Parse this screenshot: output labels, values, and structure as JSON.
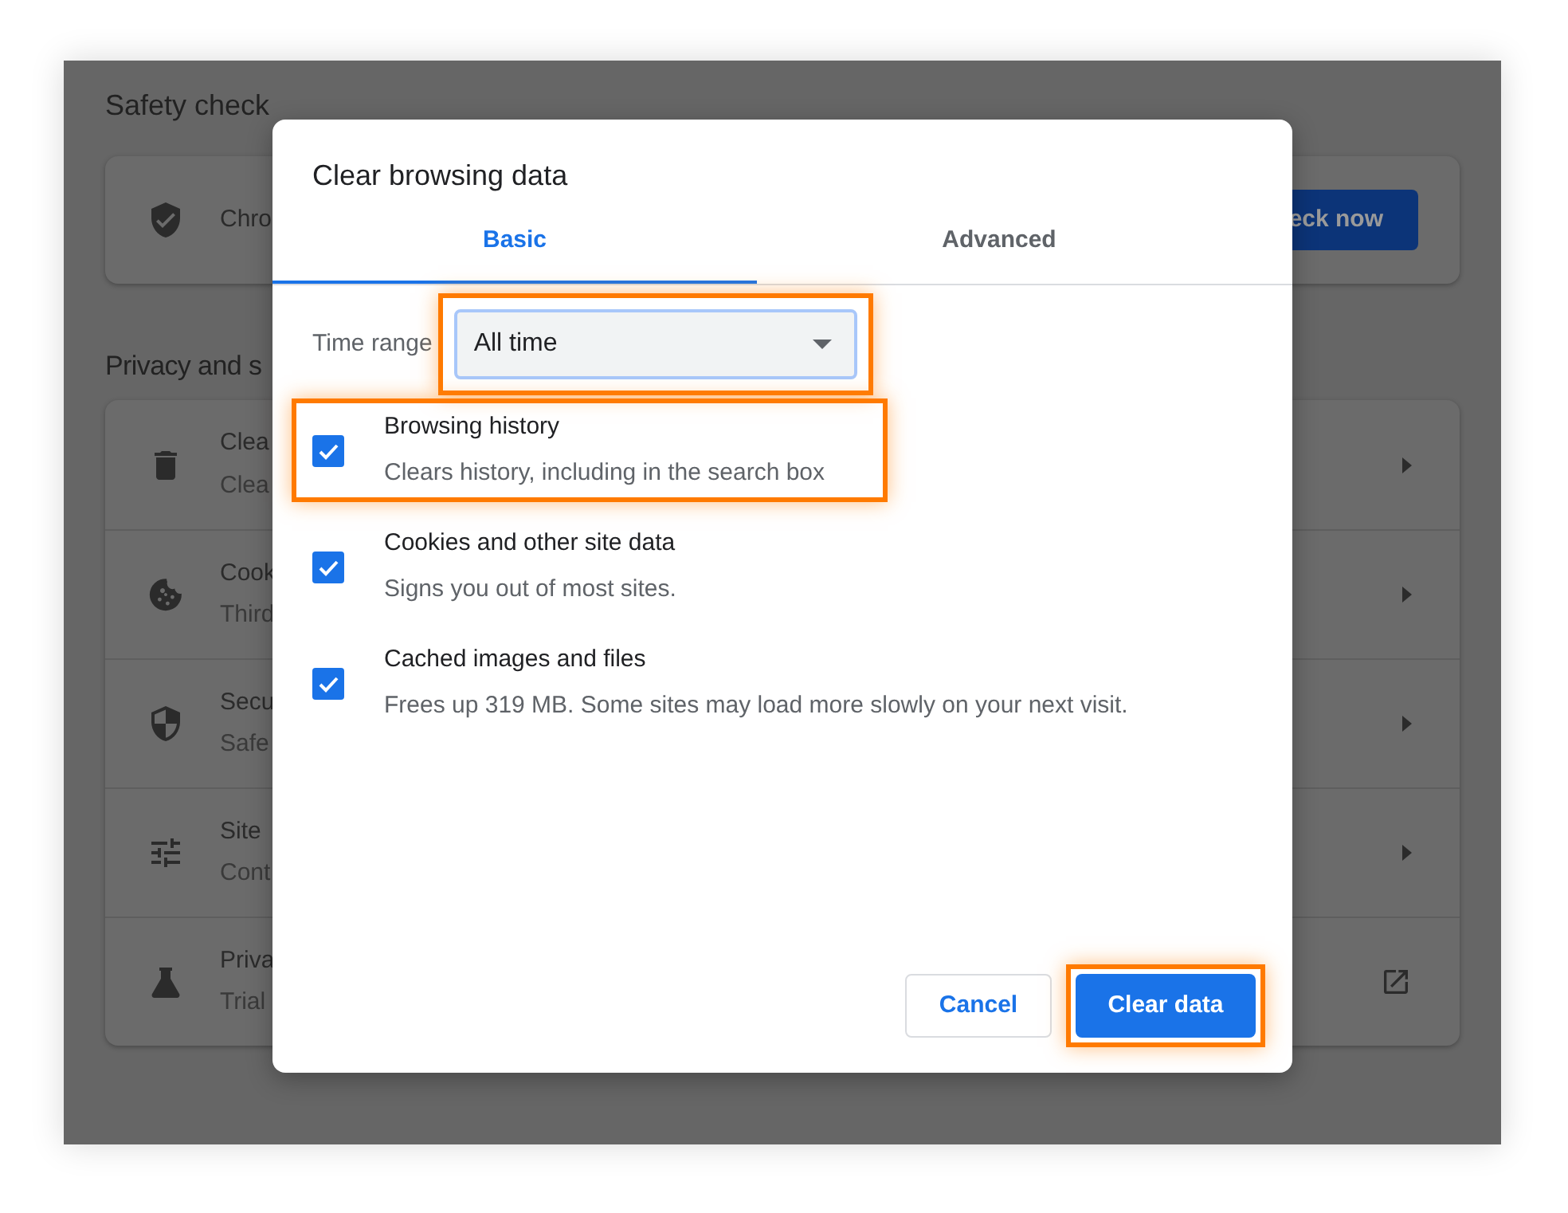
{
  "background": {
    "safety_heading": "Safety check",
    "safety_text": "Chro",
    "safety_button": "eck now",
    "privacy_heading": "Privacy and s",
    "rows": [
      {
        "kind": "trash",
        "title": "Clea",
        "subtitle": "Clea",
        "external": false
      },
      {
        "kind": "cookie",
        "title": "Cook",
        "subtitle": "Third",
        "external": false
      },
      {
        "kind": "shield",
        "title": "Secu",
        "subtitle": "Safe",
        "external": false
      },
      {
        "kind": "sliders",
        "title": "Site",
        "subtitle": "Cont",
        "external": false
      },
      {
        "kind": "flask",
        "title": "Priva",
        "subtitle": "Trial",
        "external": true
      }
    ]
  },
  "dialog": {
    "title": "Clear browsing data",
    "tabs": [
      {
        "label": "Basic",
        "selected": true
      },
      {
        "label": "Advanced",
        "selected": false
      }
    ],
    "time_range": {
      "label": "Time range",
      "value": "All time",
      "highlighted": true
    },
    "items": [
      {
        "title": "Browsing history",
        "description": "Clears history, including in the search box",
        "checked": true,
        "highlighted": true
      },
      {
        "title": "Cookies and other site data",
        "description": "Signs you out of most sites.",
        "checked": true,
        "highlighted": false
      },
      {
        "title": "Cached images and files",
        "description": "Frees up 319 MB. Some sites may load more slowly on your next visit.",
        "checked": true,
        "highlighted": false
      }
    ],
    "cancel": {
      "label": "Cancel",
      "highlighted": false
    },
    "confirm": {
      "label": "Clear data",
      "highlighted": true
    }
  }
}
